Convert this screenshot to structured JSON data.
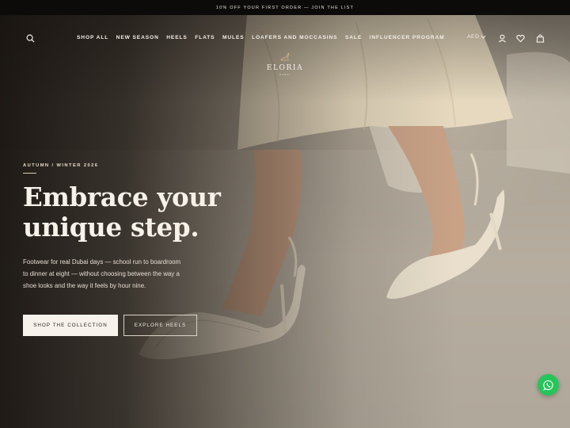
{
  "announcement": {
    "text": "10% OFF YOUR FIRST ORDER — JOIN THE LIST"
  },
  "header": {
    "nav": [
      "SHOP ALL",
      "NEW SEASON",
      "HEELS",
      "FLATS",
      "MULES",
      "LOAFERS AND MOCCASINS",
      "SALE",
      "INFLUENCER PROGRAM"
    ],
    "currency": "AED",
    "logo": {
      "name": "ELORIA",
      "sub": "DUBAI"
    },
    "icons": [
      "search-icon",
      "chevron-down-icon",
      "account-icon",
      "heart-icon",
      "bag-icon"
    ]
  },
  "hero": {
    "eyebrow": "AUTUMN / WINTER 2026",
    "headline_line1": "Embrace your",
    "headline_line2": "unique step.",
    "lede": "Footwear for real Dubai days — school run to boardroom to dinner at eight — without choosing between the way a shoe looks and the way it feels by hour nine.",
    "primary_cta": "SHOP THE COLLECTION",
    "secondary_cta": "EXPLORE HEELS"
  },
  "colors": {
    "announcement_bg": "#0c0b0a",
    "text_light": "#f6f1e9",
    "button_bg": "#f7f3ec",
    "whatsapp": "#26c55a"
  },
  "widgets": {
    "chat": "whatsapp-icon"
  }
}
